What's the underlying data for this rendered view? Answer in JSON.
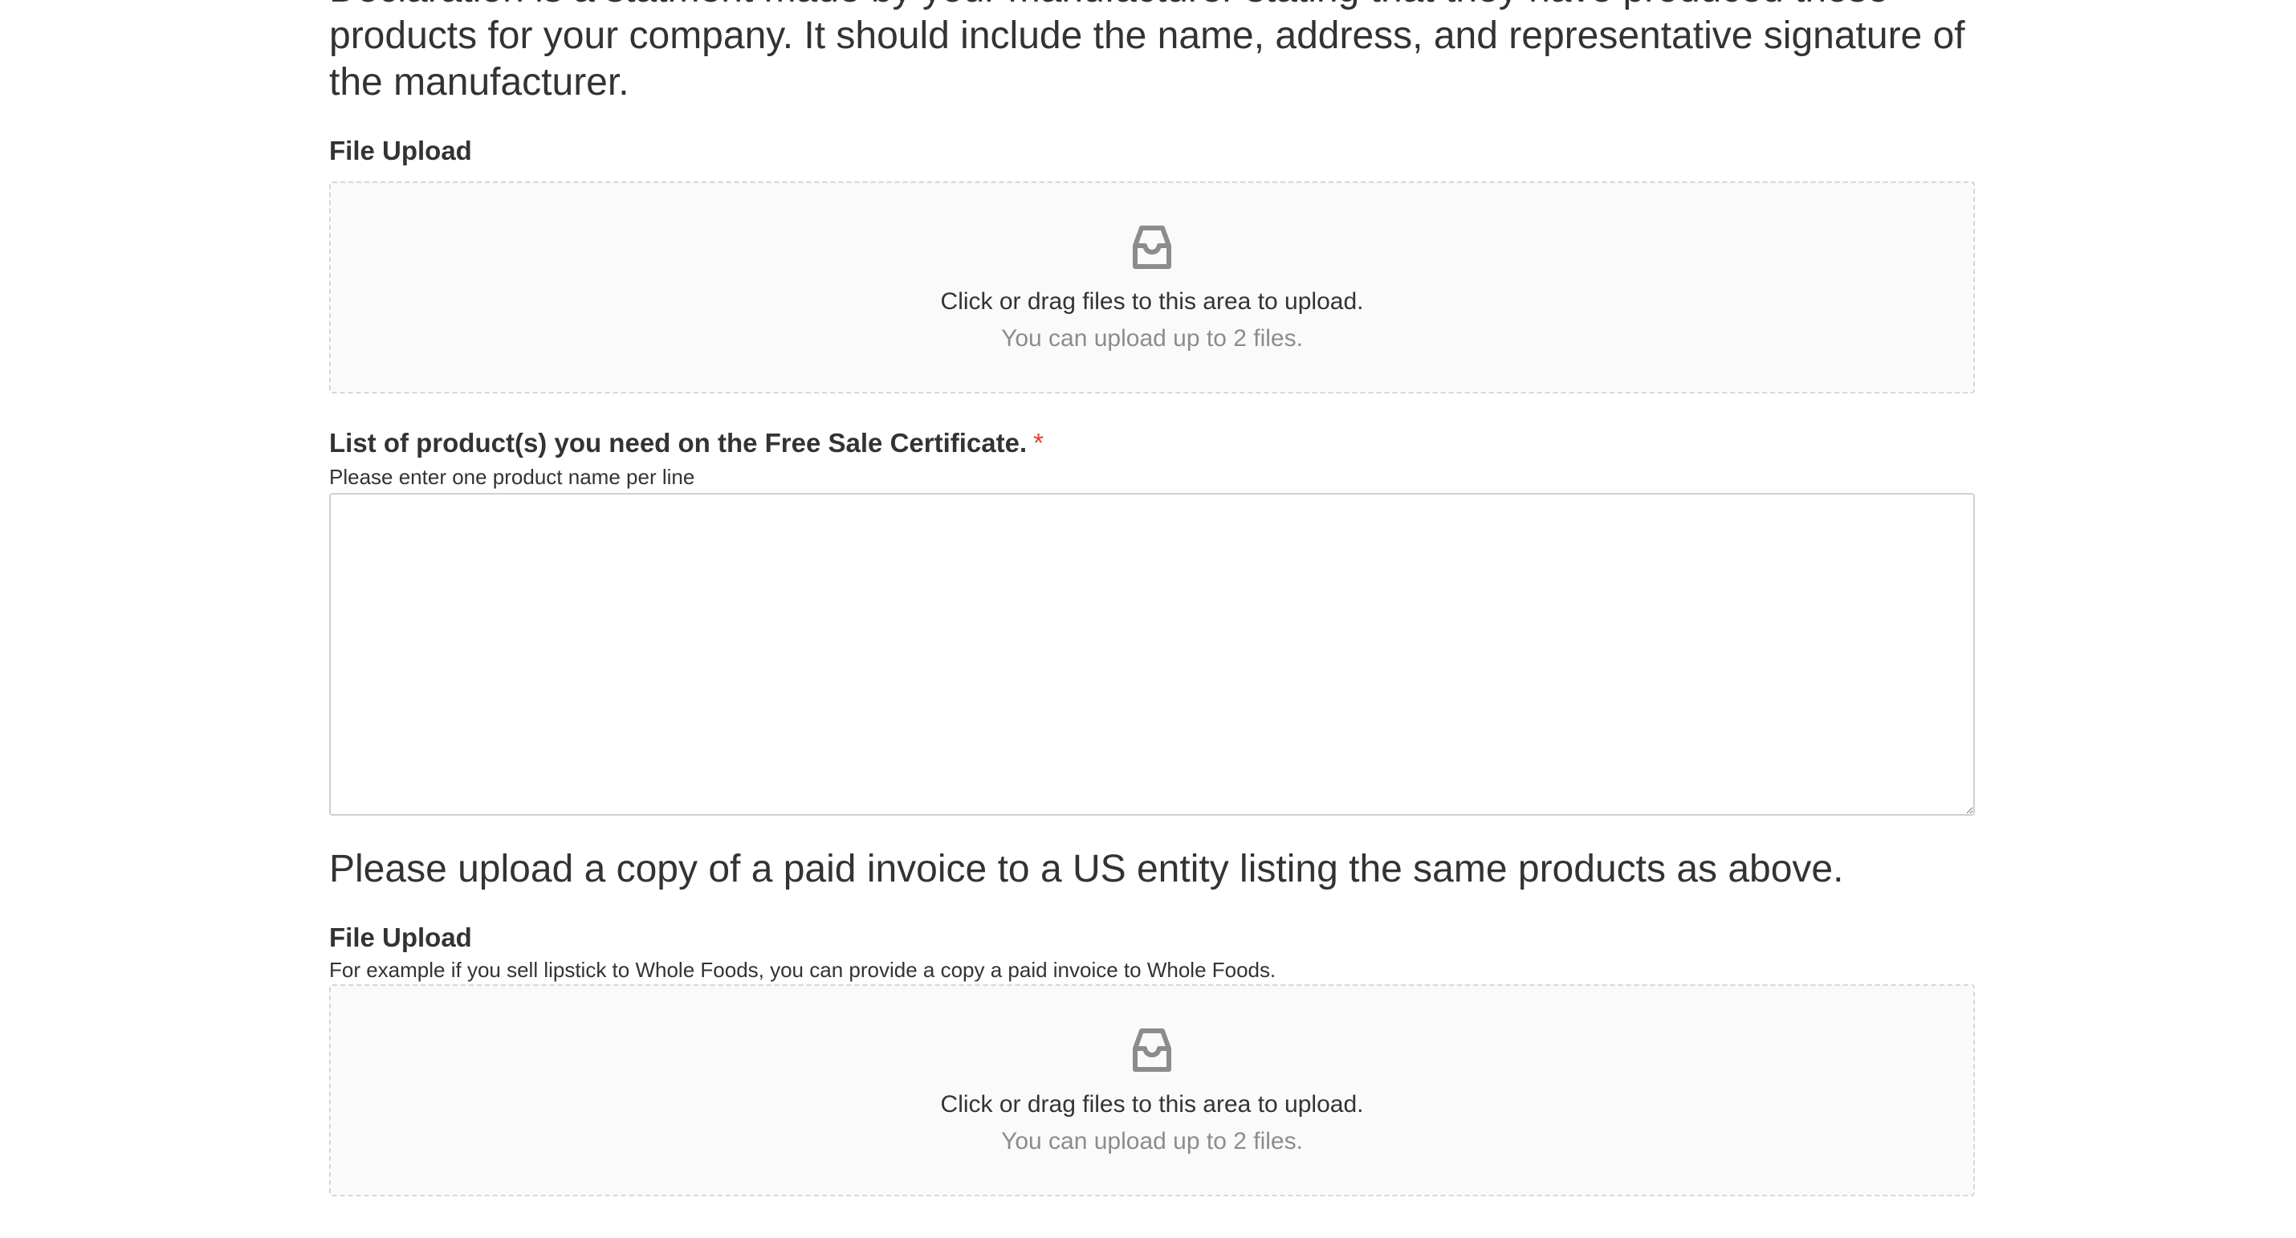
{
  "intro": {
    "line1": "Declaration is a statment made by your manufacturer stating that they have produced these",
    "line2": "products for your company. It should include the name, address, and representative signature of",
    "line3": "the manufacturer."
  },
  "upload1": {
    "label": "File Upload",
    "text": "Click or drag files to this area to upload.",
    "hint": "You can upload up to 2 files."
  },
  "products": {
    "label": "List of product(s) you need on the Free Sale Certificate.",
    "required_mark": "*",
    "help": "Please enter one product name per line",
    "value": ""
  },
  "invoice": {
    "heading": "Please upload a copy of a paid invoice to a US entity listing the same products as above."
  },
  "upload2": {
    "label": "File Upload",
    "help": "For example if you sell lipstick to Whole Foods, you can provide a copy a paid invoice to Whole Foods.",
    "text": "Click or drag files to this area to upload.",
    "hint": "You can upload up to 2 files."
  },
  "icons": {
    "upload": "inbox-icon"
  },
  "colors": {
    "required": "#e53935",
    "text": "#333333",
    "hint": "#8c8c8c",
    "dropzone_bg": "#fafafa",
    "dropzone_border": "#d6d6d6"
  }
}
